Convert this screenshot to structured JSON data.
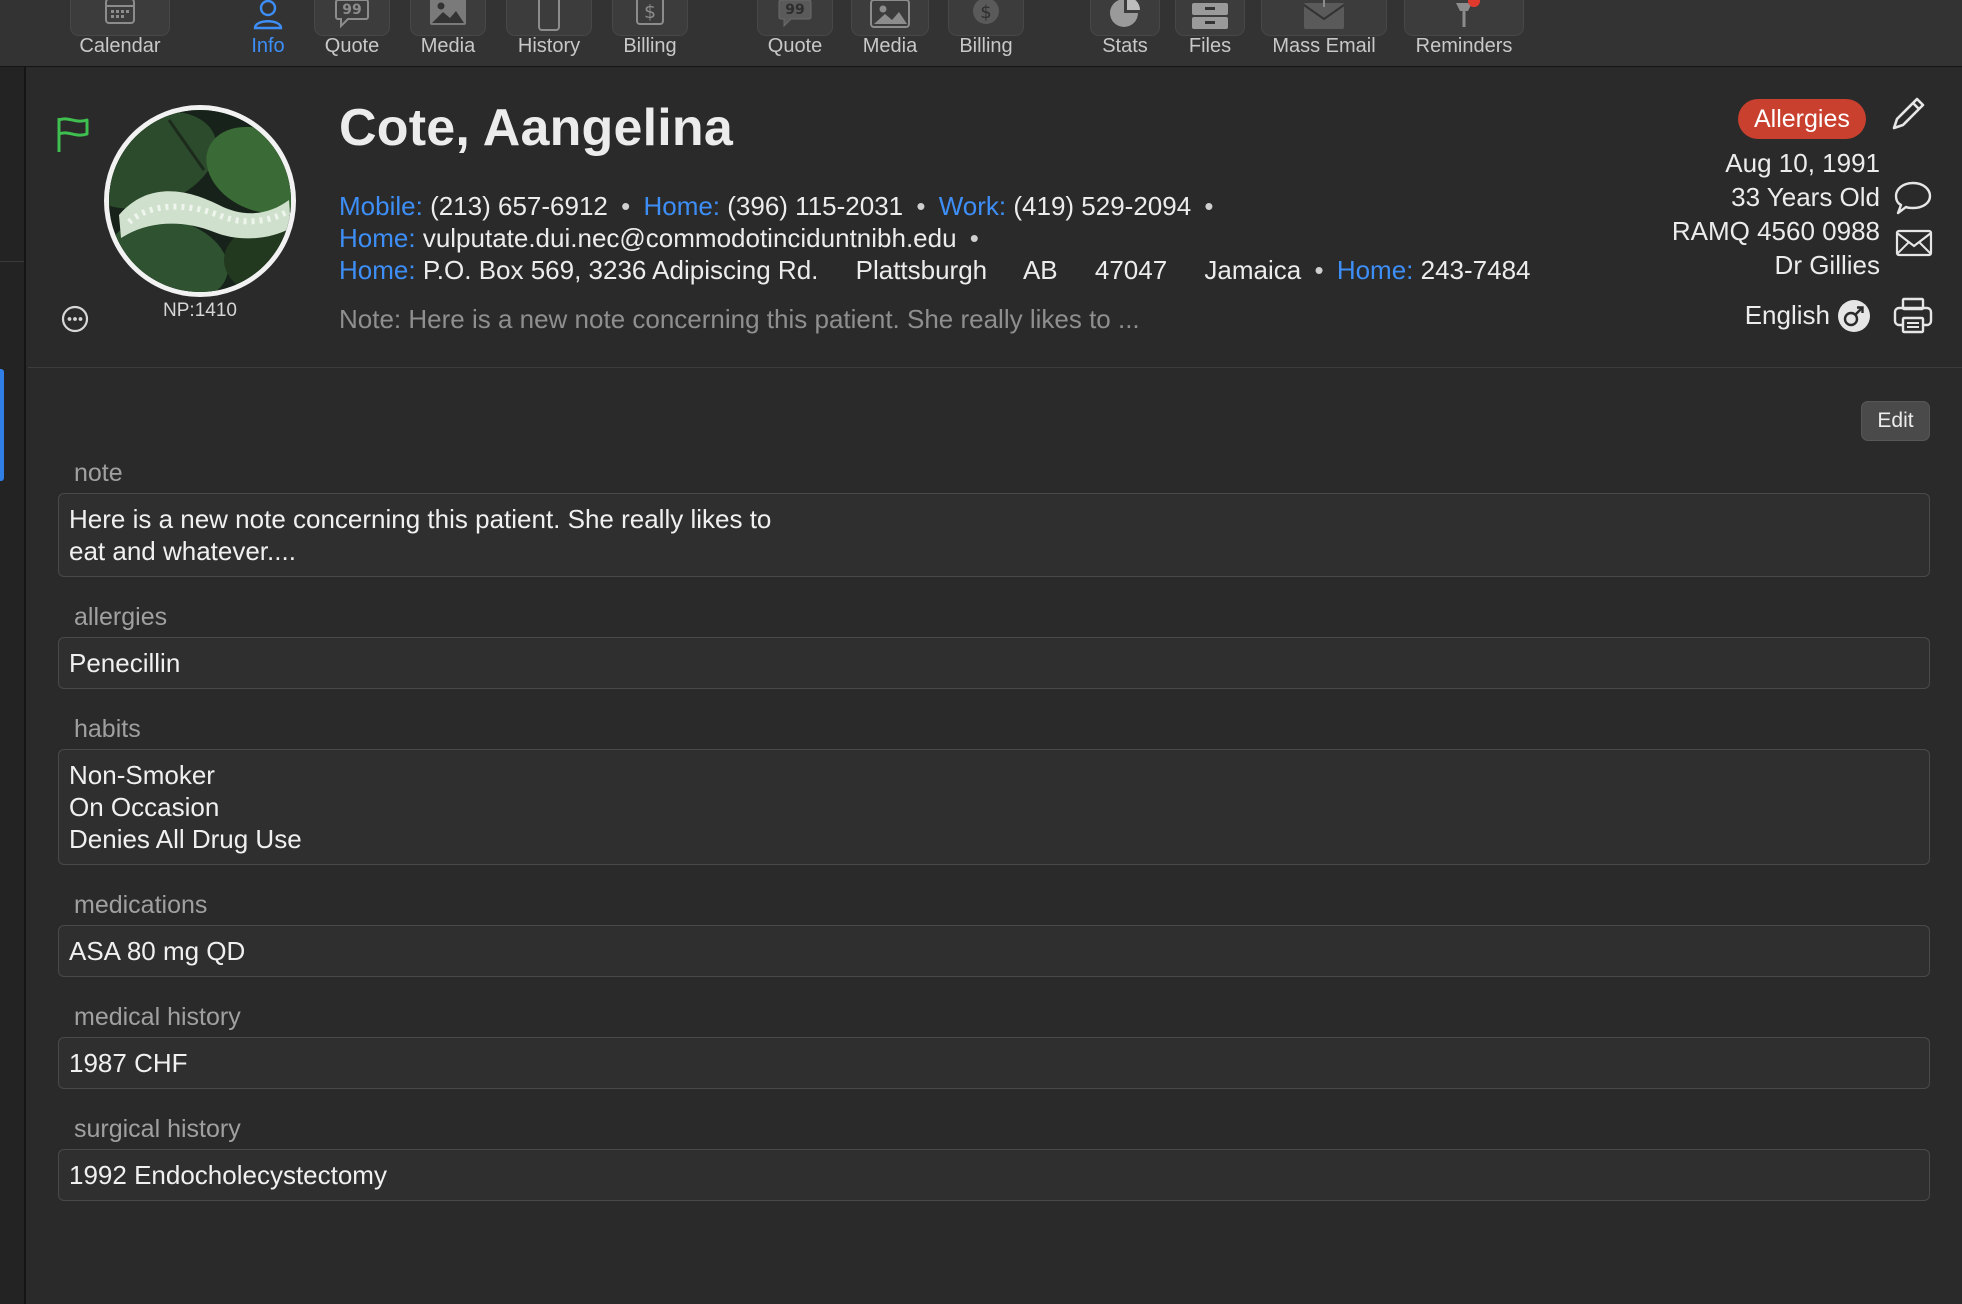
{
  "toolbar": {
    "items": [
      {
        "label": "Calendar",
        "icon": "calendar-icon"
      },
      {
        "label": "Info",
        "icon": "person-icon",
        "active": true
      },
      {
        "label": "Quote",
        "icon": "quote-bubble-icon"
      },
      {
        "label": "Media",
        "icon": "photo-icon"
      },
      {
        "label": "History",
        "icon": "phone-device-icon"
      },
      {
        "label": "Billing",
        "icon": "dollar-doc-icon"
      },
      {
        "label": "Quote",
        "icon": "quote-bubble-icon"
      },
      {
        "label": "Media",
        "icon": "photo-icon"
      },
      {
        "label": "Billing",
        "icon": "dollar-circle-icon"
      },
      {
        "label": "Stats",
        "icon": "pie-chart-icon"
      },
      {
        "label": "Files",
        "icon": "file-box-icon"
      },
      {
        "label": "Mass Email",
        "icon": "mass-email-icon"
      },
      {
        "label": "Reminders",
        "icon": "pin-icon"
      }
    ],
    "active_color": "#3d8ef7"
  },
  "patient": {
    "name": "Cote, Aangelina",
    "np": "NP:1410",
    "phones": {
      "mobile_label": "Mobile:",
      "mobile": "(213) 657-6912",
      "home_label": "Home:",
      "home": "(396) 115-2031",
      "work_label": "Work:",
      "work": "(419) 529-2094"
    },
    "email": {
      "label": "Home:",
      "value": "vulputate.dui.nec@commodotinciduntnibh.edu"
    },
    "address": {
      "label": "Home:",
      "street": "P.O. Box 569, 3236 Adipiscing Rd.",
      "city": "Plattsburgh",
      "province": "AB",
      "postal": "47047",
      "country": "Jamaica",
      "phone_label": "Home:",
      "phone": "243-7484"
    },
    "note_preview": "Note: Here is a new note concerning this patient. She really likes to ...",
    "allergies_badge": "Allergies",
    "dob": "Aug 10, 1991",
    "age": "33 Years Old",
    "ramq": "RAMQ 4560 0988",
    "doctor": "Dr Gillies",
    "language": "English"
  },
  "main": {
    "edit_label": "Edit",
    "fields": [
      {
        "label": "note",
        "lines": [
          "Here is a new note concerning this patient. She really likes to",
          "eat and whatever...."
        ]
      },
      {
        "label": "allergies",
        "lines": [
          "Penecillin"
        ]
      },
      {
        "label": "habits",
        "lines": [
          "Non-Smoker",
          "On Occasion",
          "Denies All Drug Use"
        ]
      },
      {
        "label": "medications",
        "lines": [
          "ASA 80 mg QD"
        ]
      },
      {
        "label": "medical history",
        "lines": [
          "1987 CHF"
        ]
      },
      {
        "label": "surgical history",
        "lines": [
          "1992 Endocholecystectomy"
        ]
      }
    ]
  },
  "colors": {
    "background": "#2a2a2a",
    "link_blue": "#3d8ef7",
    "badge_red": "#c9402f",
    "flag_green": "#3fbf4f"
  }
}
